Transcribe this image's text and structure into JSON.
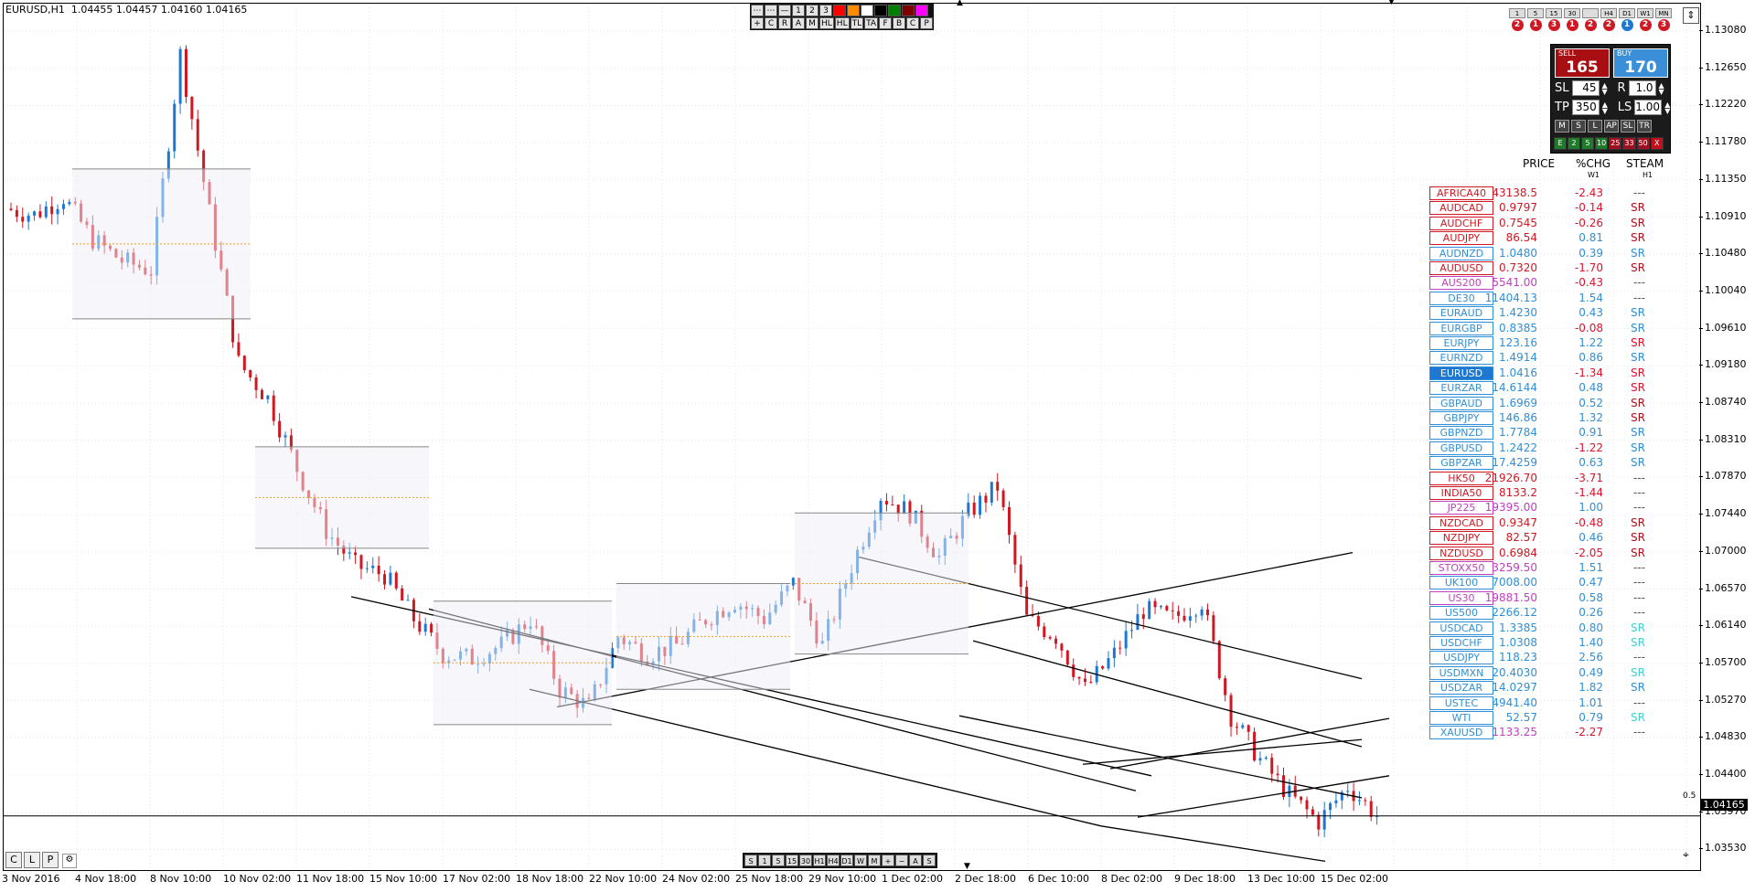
{
  "chart_header": {
    "symbol_timeframe": "EURUSD,H1",
    "ohlc": "1.04455 1.04457 1.04160 1.04165"
  },
  "colors": {
    "bull_candle": "#1e78d2",
    "bear_candle": "#d01822",
    "background": "#ffffff",
    "trendline": "#000000"
  },
  "toolbar_top": {
    "row1": [
      "⋯",
      "⋯",
      "—",
      "1",
      "2",
      "3"
    ],
    "row1_colors": [
      "#ff0000",
      "#ff8c00",
      "#ffffff",
      "#000000",
      "#008000",
      "#800000",
      "#ff00ff"
    ],
    "row2": [
      "+",
      "C",
      "R",
      "A",
      "M",
      "HL",
      "HL",
      "TL",
      "TA",
      "F",
      "B",
      "C",
      "P"
    ]
  },
  "timeframes": [
    {
      "label": "1",
      "badge": "2",
      "badge_color": "#d01822"
    },
    {
      "label": "5",
      "badge": "1",
      "badge_color": "#d01822"
    },
    {
      "label": "15",
      "badge": "3",
      "badge_color": "#d01822"
    },
    {
      "label": "30",
      "badge": "1",
      "badge_color": "#d01822"
    },
    {
      "label": "",
      "badge": "2",
      "badge_color": "#d01822"
    },
    {
      "label": "H4",
      "badge": "2",
      "badge_color": "#d01822"
    },
    {
      "label": "D1",
      "badge": "1",
      "badge_color": "#1e78d2"
    },
    {
      "label": "W1",
      "badge": "2",
      "badge_color": "#d01822"
    },
    {
      "label": "MN",
      "badge": "3",
      "badge_color": "#d01822"
    }
  ],
  "trade_panel": {
    "sell_label": "SELL",
    "sell_value": "165",
    "buy_label": "BUY",
    "buy_value": "170",
    "sl_label": "SL",
    "sl_value": "45",
    "r_label": "R",
    "r_value": "1.0",
    "tp_label": "TP",
    "tp_value": "350",
    "ls_label": "LS",
    "ls_value": "1.00",
    "mode_buttons": [
      "M",
      "S",
      "L",
      "AP",
      "SL",
      "TR"
    ],
    "green_buttons": [
      "E",
      "2",
      "5",
      "10",
      "25",
      "33",
      "50",
      "X"
    ]
  },
  "watchlist": {
    "headers": {
      "price": "PRICE",
      "chg": "%CHG",
      "chg_sub": "W1",
      "steam": "STEAM",
      "steam_sub": "H1"
    },
    "rows": [
      {
        "symbol": "AFRICA40",
        "price": "43138.5",
        "chg": "-2.43",
        "sr": "---",
        "color": "#d01822",
        "sr_color": "#555"
      },
      {
        "symbol": "AUDCAD",
        "price": "0.9797",
        "chg": "-0.14",
        "sr": "SR",
        "color": "#d01822",
        "sr_color": "#b0101c"
      },
      {
        "symbol": "AUDCHF",
        "price": "0.7545",
        "chg": "-0.26",
        "sr": "SR",
        "color": "#d01822",
        "sr_color": "#b0101c"
      },
      {
        "symbol": "AUDJPY",
        "price": "86.54",
        "chg": "0.81",
        "sr": "SR",
        "color": "#d01822",
        "sr_color": "#b0101c"
      },
      {
        "symbol": "AUDNZD",
        "price": "1.0480",
        "chg": "0.39",
        "sr": "SR",
        "color": "#2f8fd8",
        "sr_color": "#2f8fd8"
      },
      {
        "symbol": "AUDUSD",
        "price": "0.7320",
        "chg": "-1.70",
        "sr": "SR",
        "color": "#d01822",
        "sr_color": "#b0101c"
      },
      {
        "symbol": "AUS200",
        "price": "5541.00",
        "chg": "-0.43",
        "sr": "---",
        "color": "#c040c0",
        "sr_color": "#555"
      },
      {
        "symbol": "DE30",
        "price": "11404.13",
        "chg": "1.54",
        "sr": "---",
        "color": "#2f8fd8",
        "sr_color": "#555"
      },
      {
        "symbol": "EURAUD",
        "price": "1.4230",
        "chg": "0.43",
        "sr": "SR",
        "color": "#2f8fd8",
        "sr_color": "#2f8fd8"
      },
      {
        "symbol": "EURGBP",
        "price": "0.8385",
        "chg": "-0.08",
        "sr": "SR",
        "color": "#2f8fd8",
        "sr_color": "#2f8fd8"
      },
      {
        "symbol": "EURJPY",
        "price": "123.16",
        "chg": "1.22",
        "sr": "SR",
        "color": "#2f8fd8",
        "sr_color": "#e0102a"
      },
      {
        "symbol": "EURNZD",
        "price": "1.4914",
        "chg": "0.86",
        "sr": "SR",
        "color": "#2f8fd8",
        "sr_color": "#2f8fd8"
      },
      {
        "symbol": "EURUSD",
        "price": "1.0416",
        "chg": "-1.34",
        "sr": "SR",
        "color": "#2f8fd8",
        "sr_color": "#e0102a",
        "selected": true
      },
      {
        "symbol": "EURZAR",
        "price": "14.6144",
        "chg": "0.48",
        "sr": "SR",
        "color": "#2f8fd8",
        "sr_color": "#e0102a"
      },
      {
        "symbol": "GBPAUD",
        "price": "1.6969",
        "chg": "0.52",
        "sr": "SR",
        "color": "#2f8fd8",
        "sr_color": "#b0101c"
      },
      {
        "symbol": "GBPJPY",
        "price": "146.86",
        "chg": "1.32",
        "sr": "SR",
        "color": "#2f8fd8",
        "sr_color": "#b0101c"
      },
      {
        "symbol": "GBPNZD",
        "price": "1.7784",
        "chg": "0.91",
        "sr": "SR",
        "color": "#2f8fd8",
        "sr_color": "#2f8fd8"
      },
      {
        "symbol": "GBPUSD",
        "price": "1.2422",
        "chg": "-1.22",
        "sr": "SR",
        "color": "#2f8fd8",
        "sr_color": "#2f8fd8"
      },
      {
        "symbol": "GBPZAR",
        "price": "17.4259",
        "chg": "0.63",
        "sr": "SR",
        "color": "#2f8fd8",
        "sr_color": "#2f8fd8"
      },
      {
        "symbol": "HK50",
        "price": "21926.70",
        "chg": "-3.71",
        "sr": "---",
        "color": "#d01822",
        "sr_color": "#555"
      },
      {
        "symbol": "INDIA50",
        "price": "8133.2",
        "chg": "-1.44",
        "sr": "---",
        "color": "#d01822",
        "sr_color": "#555"
      },
      {
        "symbol": "JP225",
        "price": "19395.00",
        "chg": "1.00",
        "sr": "---",
        "color": "#c040c0",
        "sr_color": "#555"
      },
      {
        "symbol": "NZDCAD",
        "price": "0.9347",
        "chg": "-0.48",
        "sr": "SR",
        "color": "#d01822",
        "sr_color": "#b0101c"
      },
      {
        "symbol": "NZDJPY",
        "price": "82.57",
        "chg": "0.46",
        "sr": "SR",
        "color": "#d01822",
        "sr_color": "#b0101c"
      },
      {
        "symbol": "NZDUSD",
        "price": "0.6984",
        "chg": "-2.05",
        "sr": "SR",
        "color": "#d01822",
        "sr_color": "#b0101c"
      },
      {
        "symbol": "STOXX50",
        "price": "3259.50",
        "chg": "1.51",
        "sr": "---",
        "color": "#c040c0",
        "sr_color": "#555"
      },
      {
        "symbol": "UK100",
        "price": "7008.00",
        "chg": "0.47",
        "sr": "---",
        "color": "#2f8fd8",
        "sr_color": "#555"
      },
      {
        "symbol": "US30",
        "price": "19881.50",
        "chg": "0.58",
        "sr": "---",
        "color": "#c040c0",
        "sr_color": "#555"
      },
      {
        "symbol": "US500",
        "price": "2266.12",
        "chg": "0.26",
        "sr": "---",
        "color": "#2f8fd8",
        "sr_color": "#555"
      },
      {
        "symbol": "USDCAD",
        "price": "1.3385",
        "chg": "0.80",
        "sr": "SR",
        "color": "#2f8fd8",
        "sr_color": "#40d0d0"
      },
      {
        "symbol": "USDCHF",
        "price": "1.0308",
        "chg": "1.40",
        "sr": "SR",
        "color": "#2f8fd8",
        "sr_color": "#40d0d0"
      },
      {
        "symbol": "USDJPY",
        "price": "118.23",
        "chg": "2.56",
        "sr": "---",
        "color": "#2f8fd8",
        "sr_color": "#555"
      },
      {
        "symbol": "USDMXN",
        "price": "20.4030",
        "chg": "0.49",
        "sr": "SR",
        "color": "#2f8fd8",
        "sr_color": "#40d0d0"
      },
      {
        "symbol": "USDZAR",
        "price": "14.0297",
        "chg": "1.82",
        "sr": "SR",
        "color": "#2f8fd8",
        "sr_color": "#2f8fd8"
      },
      {
        "symbol": "USTEC",
        "price": "4941.40",
        "chg": "1.01",
        "sr": "---",
        "color": "#2f8fd8",
        "sr_color": "#555"
      },
      {
        "symbol": "WTI",
        "price": "52.57",
        "chg": "0.79",
        "sr": "SR",
        "color": "#2f8fd8",
        "sr_color": "#40d0d0"
      },
      {
        "symbol": "XAUUSD",
        "price": "1133.25",
        "chg": "-2.27",
        "sr": "---",
        "color": "#2f8fd8",
        "sr_color": "#555",
        "price_color": "#c040c0"
      }
    ]
  },
  "y_axis": {
    "labels": [
      "1.13080",
      "1.12650",
      "1.12220",
      "1.11780",
      "1.11350",
      "1.10910",
      "1.10480",
      "1.10040",
      "1.09610",
      "1.09180",
      "1.08740",
      "1.08310",
      "1.07870",
      "1.07440",
      "1.07000",
      "1.06570",
      "1.06140",
      "1.05700",
      "1.05270",
      "1.04830",
      "1.04400",
      "1.03970",
      "1.03530"
    ],
    "current_price": "1.04165",
    "small_label": "0.5"
  },
  "x_axis": {
    "labels": [
      "3 Nov 2016",
      "4 Nov 18:00",
      "8 Nov 10:00",
      "10 Nov 02:00",
      "11 Nov 18:00",
      "15 Nov 10:00",
      "17 Nov 02:00",
      "18 Nov 18:00",
      "22 Nov 10:00",
      "24 Nov 02:00",
      "25 Nov 18:00",
      "29 Nov 10:00",
      "1 Dec 02:00",
      "2 Dec 18:00",
      "6 Dec 10:00",
      "8 Dec 02:00",
      "9 Dec 18:00",
      "13 Dec 10:00",
      "15 Dec 02:00"
    ]
  },
  "bottom_left": [
    "C",
    "L",
    "P"
  ],
  "toolbar_bottom": [
    "S",
    "1",
    "5",
    "15",
    "30",
    "H1",
    "H4",
    "D1",
    "W",
    "M",
    "+",
    "−",
    "A",
    "S"
  ],
  "chart_data": {
    "type": "candlestick",
    "symbol": "EURUSD",
    "timeframe": "H1",
    "ylim": [
      1.0353,
      1.1325
    ],
    "x": [
      "3 Nov 2016",
      "4 Nov 18:00",
      "8 Nov 10:00",
      "10 Nov 02:00",
      "11 Nov 18:00",
      "15 Nov 10:00",
      "17 Nov 02:00",
      "18 Nov 18:00",
      "22 Nov 10:00",
      "24 Nov 02:00",
      "25 Nov 18:00",
      "29 Nov 10:00",
      "1 Dec 02:00",
      "2 Dec 18:00",
      "6 Dec 10:00",
      "8 Dec 02:00",
      "9 Dec 18:00",
      "13 Dec 10:00",
      "15 Dec 02:00"
    ],
    "close_path": [
      1.1105,
      1.1098,
      1.1118,
      1.107,
      1.1046,
      1.1035,
      1.128,
      1.11,
      1.093,
      1.089,
      1.081,
      1.074,
      1.07,
      1.069,
      1.064,
      1.06,
      1.0595,
      1.061,
      1.064,
      1.056,
      1.054,
      1.062,
      1.06,
      1.061,
      1.064,
      1.066,
      1.064,
      1.068,
      1.061,
      1.07,
      1.078,
      1.076,
      1.071,
      1.076,
      1.079,
      1.064,
      1.062,
      1.056,
      1.06,
      1.065,
      1.064,
      1.066,
      1.053,
      1.048,
      1.044,
      1.041,
      1.045,
      1.0417
    ],
    "current_price": 1.04165,
    "grid": true
  }
}
